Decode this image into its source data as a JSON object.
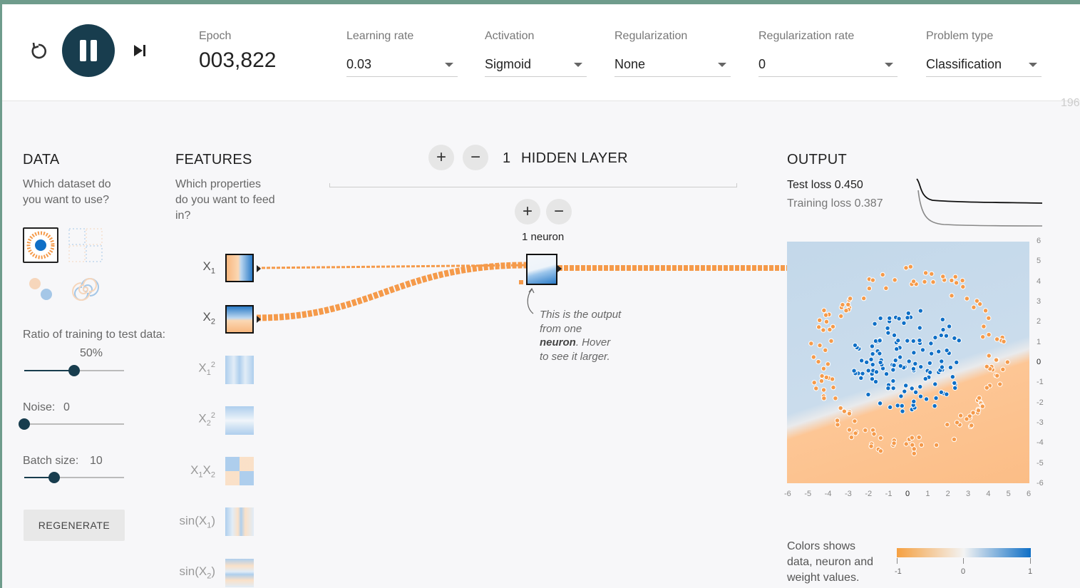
{
  "toolbar": {
    "epoch_label": "Epoch",
    "epoch_value": "003,822",
    "controls": [
      {
        "label": "Learning rate",
        "value": "0.03"
      },
      {
        "label": "Activation",
        "value": "Sigmoid"
      },
      {
        "label": "Regularization",
        "value": "None"
      },
      {
        "label": "Regularization rate",
        "value": "0"
      },
      {
        "label": "Problem type",
        "value": "Classification"
      }
    ],
    "overflow_text": "196"
  },
  "data_panel": {
    "heading": "DATA",
    "question": "Which dataset do you want to use?",
    "ratio_label": "Ratio of training to test data:",
    "ratio_value": "50%",
    "ratio_fraction": 0.5,
    "noise_label": "Noise:",
    "noise_value": "0",
    "noise_fraction": 0.0,
    "batch_label": "Batch size:",
    "batch_value": "10",
    "batch_fraction": 0.3,
    "regenerate_label": "REGENERATE"
  },
  "features_panel": {
    "heading": "FEATURES",
    "question": "Which properties do you want to feed in?"
  },
  "network": {
    "layers_count": "1",
    "layers_label": "HIDDEN LAYER",
    "neuron_label": "1 neuron",
    "annotation_line1": "This is the output",
    "annotation_line2": "from one",
    "annotation_bold": "neuron",
    "annotation_line3": ". Hover",
    "annotation_line4": "to see it larger."
  },
  "output_panel": {
    "heading": "OUTPUT",
    "test_loss_label": "Test loss",
    "test_loss_value": "0.450",
    "training_loss_label": "Training loss",
    "training_loss_value": "0.387",
    "x_ticks": [
      "-6",
      "-5",
      "-4",
      "-3",
      "-2",
      "-1",
      "0",
      "1",
      "2",
      "3",
      "4",
      "5",
      "6"
    ],
    "y_ticks": [
      "6",
      "5",
      "4",
      "3",
      "2",
      "1",
      "0",
      "-1",
      "-2",
      "-3",
      "-4",
      "-5",
      "-6"
    ],
    "legend_line1": "Colors shows",
    "legend_line2": "data, neuron and",
    "legend_line3": "weight values.",
    "scale_labels": [
      "-1",
      "0",
      "1"
    ]
  },
  "colors": {
    "orange": "#f59a4a",
    "blue": "#0f6fc6",
    "dark": "#183d4e"
  }
}
